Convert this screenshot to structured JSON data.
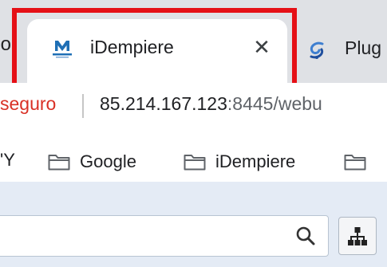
{
  "tabs": {
    "previous_tab_fragment": "o",
    "active": {
      "title": "iDempiere",
      "favicon": "idempiere-logo-icon",
      "close_glyph": "✕"
    },
    "next": {
      "title": "Plug",
      "favicon": "swirl-icon"
    }
  },
  "address_bar": {
    "security_label": "seguro",
    "url_host": "85.214.167.123",
    "url_rest": ":8445/webu"
  },
  "bookmarks": {
    "cut_label": "'Y",
    "items": [
      {
        "label": "Google",
        "icon": "folder-icon"
      },
      {
        "label": "iDempiere",
        "icon": "folder-icon"
      },
      {
        "label": "",
        "icon": "folder-icon"
      }
    ]
  },
  "page": {
    "search": {
      "value": "",
      "placeholder": "",
      "icon": "search-icon"
    },
    "tree_button": {
      "icon": "tree-icon"
    }
  },
  "colors": {
    "highlight": "#e51016",
    "not_secure": "#d93025",
    "tab_strip": "#dfe1e5",
    "page_background": "#e4ebf5"
  }
}
